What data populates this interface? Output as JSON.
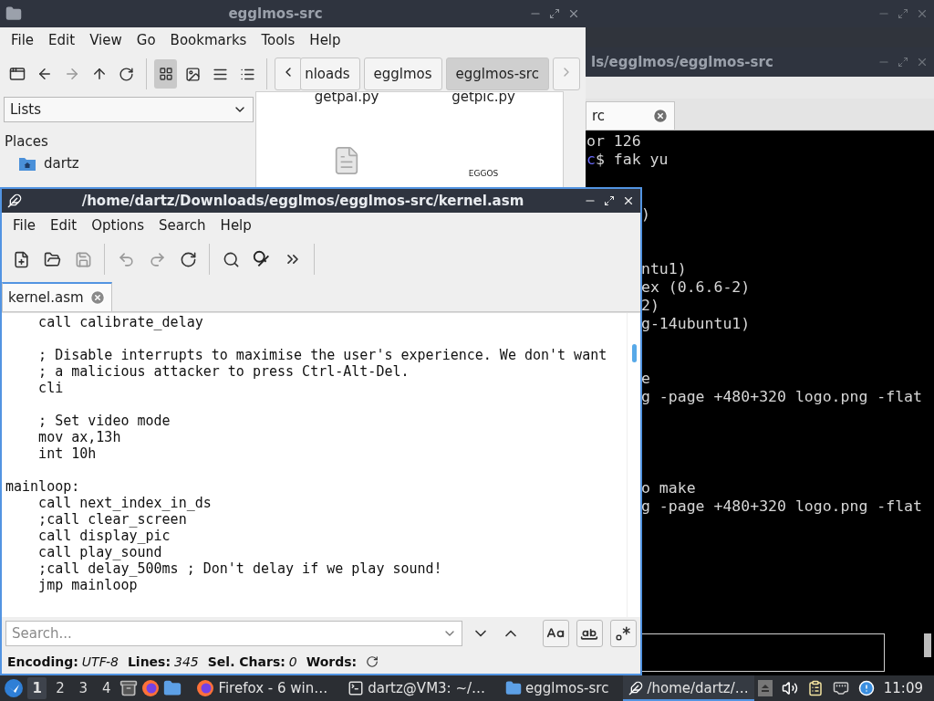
{
  "file_manager": {
    "title": "egglmos-src",
    "menu": [
      "File",
      "Edit",
      "View",
      "Go",
      "Bookmarks",
      "Tools",
      "Help"
    ],
    "view_modes": [
      {
        "kind": "icons",
        "selected": true
      },
      {
        "kind": "thumbnails",
        "selected": false
      },
      {
        "kind": "compact",
        "selected": false
      },
      {
        "kind": "details",
        "selected": false
      }
    ],
    "path": [
      {
        "label": "nloads",
        "selected": false
      },
      {
        "label": "egglmos",
        "selected": false
      },
      {
        "label": "egglmos-src",
        "selected": true
      }
    ],
    "side_pane": {
      "dropdown": "Lists",
      "heading": "Places",
      "items": [
        {
          "label": "dartz"
        }
      ]
    },
    "files": [
      {
        "kind": "label",
        "name": "getpal.py"
      },
      {
        "kind": "label",
        "name": "getpic.py"
      },
      {
        "kind": "document"
      },
      {
        "kind": "image",
        "caption": "EGGOS"
      }
    ]
  },
  "terminal": {
    "title": "ls/egglmos/egglmos-src",
    "tab": {
      "label": "rc"
    },
    "lines": [
      {
        "kind": "text",
        "text": "or 126"
      },
      {
        "kind": "prompt",
        "prompt": "c",
        "text": "$ fak yu"
      },
      {
        "kind": "blank"
      },
      {
        "kind": "blank"
      },
      {
        "kind": "text",
        "text": ")"
      },
      {
        "kind": "blank"
      },
      {
        "kind": "blank"
      },
      {
        "kind": "text",
        "text": "ntu1)"
      },
      {
        "kind": "text",
        "text": "ex (0.6.6-2)"
      },
      {
        "kind": "text",
        "text": "2)"
      },
      {
        "kind": "text",
        "text": "g-14ubuntu1)"
      },
      {
        "kind": "blank"
      },
      {
        "kind": "blank"
      },
      {
        "kind": "text",
        "text": "e"
      },
      {
        "kind": "text",
        "text": "g -page +480+320 logo.png -flat"
      },
      {
        "kind": "blank"
      },
      {
        "kind": "blank"
      },
      {
        "kind": "blank"
      },
      {
        "kind": "blank"
      },
      {
        "kind": "text",
        "text": "o make"
      },
      {
        "kind": "text",
        "text": "g -page +480+320 logo.png -flat"
      }
    ]
  },
  "editor": {
    "title": "/home/dartz/Downloads/egglmos/egglmos-src/kernel.asm",
    "menu": [
      "File",
      "Edit",
      "Options",
      "Search",
      "Help"
    ],
    "tabs": [
      {
        "label": "kernel.asm",
        "selected": true
      }
    ],
    "code": [
      {
        "kind": "text",
        "text": "    call calibrate_delay"
      },
      {
        "kind": "blank"
      },
      {
        "kind": "text",
        "text": "    ; Disable interrupts to maximise the user's experience. We don't want"
      },
      {
        "kind": "text",
        "text": "    ; a malicious attacker to press Ctrl-Alt-Del."
      },
      {
        "kind": "text",
        "text": "    cli"
      },
      {
        "kind": "blank"
      },
      {
        "kind": "text",
        "text": "    ; Set video mode"
      },
      {
        "kind": "text",
        "text": "    mov ax,13h"
      },
      {
        "kind": "text",
        "text": "    int 10h"
      },
      {
        "kind": "blank"
      },
      {
        "kind": "text",
        "text": "mainloop:"
      },
      {
        "kind": "text",
        "text": "    call next_index_in_ds"
      },
      {
        "kind": "text",
        "text": "    ;call clear_screen"
      },
      {
        "kind": "text",
        "text": "    call display_pic"
      },
      {
        "kind": "text",
        "text": "    call play_sound"
      },
      {
        "kind": "text",
        "text": "    ;call delay_500ms ; Don't delay if we play sound!"
      },
      {
        "kind": "text",
        "text": "    jmp mainloop"
      }
    ],
    "search": {
      "placeholder": "Search..."
    },
    "status": [
      {
        "label": "Encoding:",
        "value": "UTF-8"
      },
      {
        "label": "Lines:",
        "value": "345"
      },
      {
        "label": "Sel. Chars:",
        "value": "0"
      },
      {
        "label": "Words:"
      }
    ]
  },
  "taskbar": {
    "workspaces": [
      {
        "label": "1",
        "selected": true
      },
      {
        "label": "2",
        "selected": false
      },
      {
        "label": "3",
        "selected": false
      },
      {
        "label": "4",
        "selected": false
      }
    ],
    "tasks": [
      {
        "kind": "firefox",
        "label": "Firefox - 6 win…",
        "selected": false
      },
      {
        "kind": "terminal",
        "label": "dartz@VM3: ~/…",
        "selected": false
      },
      {
        "kind": "folder",
        "label": "egglmos-src",
        "selected": false
      },
      {
        "kind": "editor",
        "label": "/home/dartz/…",
        "selected": true
      }
    ],
    "clock": "11:09"
  }
}
